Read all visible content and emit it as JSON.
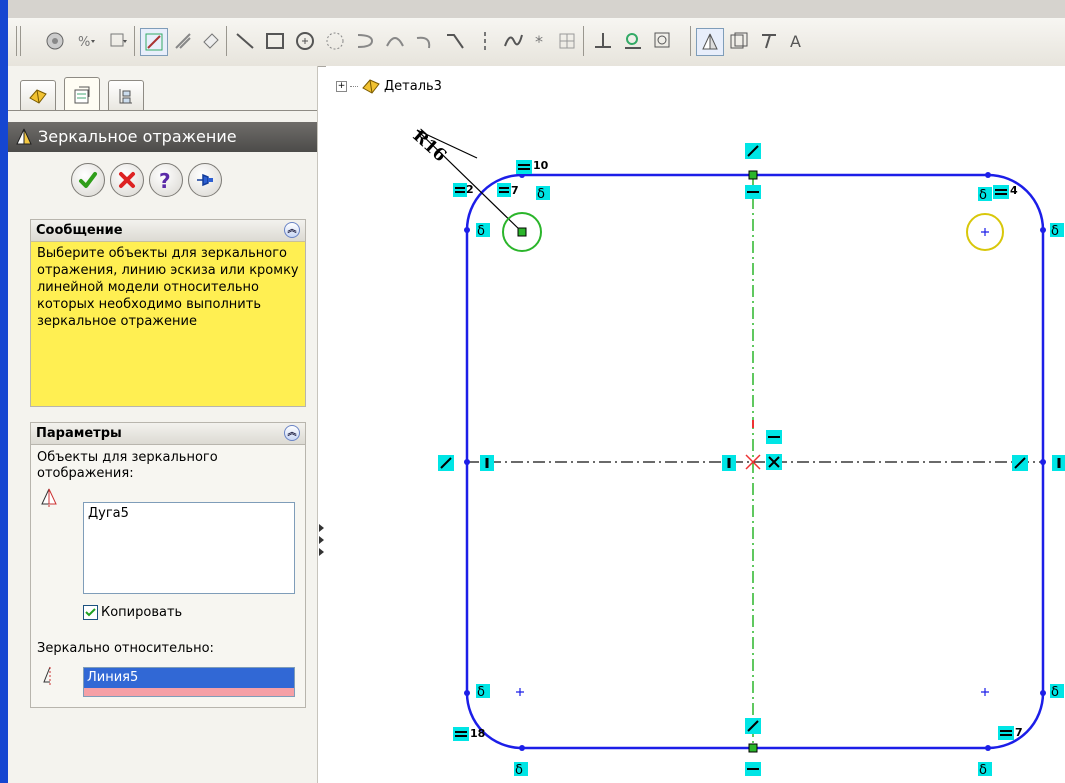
{
  "window": {
    "accent_color": "#1546d1",
    "canvas_bg": "#ffffff"
  },
  "toolbar": {
    "icons": [
      "feature-icon",
      "smart-dimension-icon",
      "relations-icon",
      "sketch-icon",
      "exit-sketch-icon",
      "eraser-icon",
      "line-icon",
      "rectangle-icon",
      "circle-icon",
      "polygon-icon",
      "slot-icon",
      "arc-icon",
      "tangent-arc-icon",
      "centerline-icon",
      "dashed-line-icon",
      "spline-icon",
      "point-icon",
      "grid-icon",
      "trim-icon",
      "convert-entities-icon",
      "offset-icon",
      "mirror-icon",
      "pattern-icon",
      "move-icon",
      "text-icon"
    ]
  },
  "panel": {
    "tabs": [
      "feature-manager-tab",
      "property-manager-tab",
      "configuration-manager-tab"
    ],
    "title": "Зеркальное отражение",
    "buttons": {
      "ok": "OK",
      "cancel": "Отмена",
      "help": "Справка",
      "pin": "Закрепить"
    },
    "message": {
      "header": "Сообщение",
      "text": "Выберите объекты для зеркального отражения, линию эскиза или кромку линейной модели относительно которых необходимо выполнить зеркальное отражение"
    },
    "parameters": {
      "header": "Параметры",
      "objects_label": "Объекты для зеркального отображения:",
      "objects_list": [
        "Дуга5"
      ],
      "copy_label": "Копировать",
      "copy_checked": true,
      "mirror_about_label": "Зеркально относительно:",
      "mirror_about_value": "Линия5"
    }
  },
  "tree": {
    "expander": "⊞",
    "label": "Деталь3"
  },
  "sketch": {
    "dimension": "R16",
    "relation_labels": [
      "10",
      "2",
      "7",
      "4",
      "18",
      "7"
    ],
    "line_color": "#1c1ee8",
    "centerline_color": "#2bb52b",
    "relation_badge_color": "#00e5e5",
    "selected_circle_color": "#2bb52b",
    "mirror_circle_color": "#d8c70a"
  }
}
